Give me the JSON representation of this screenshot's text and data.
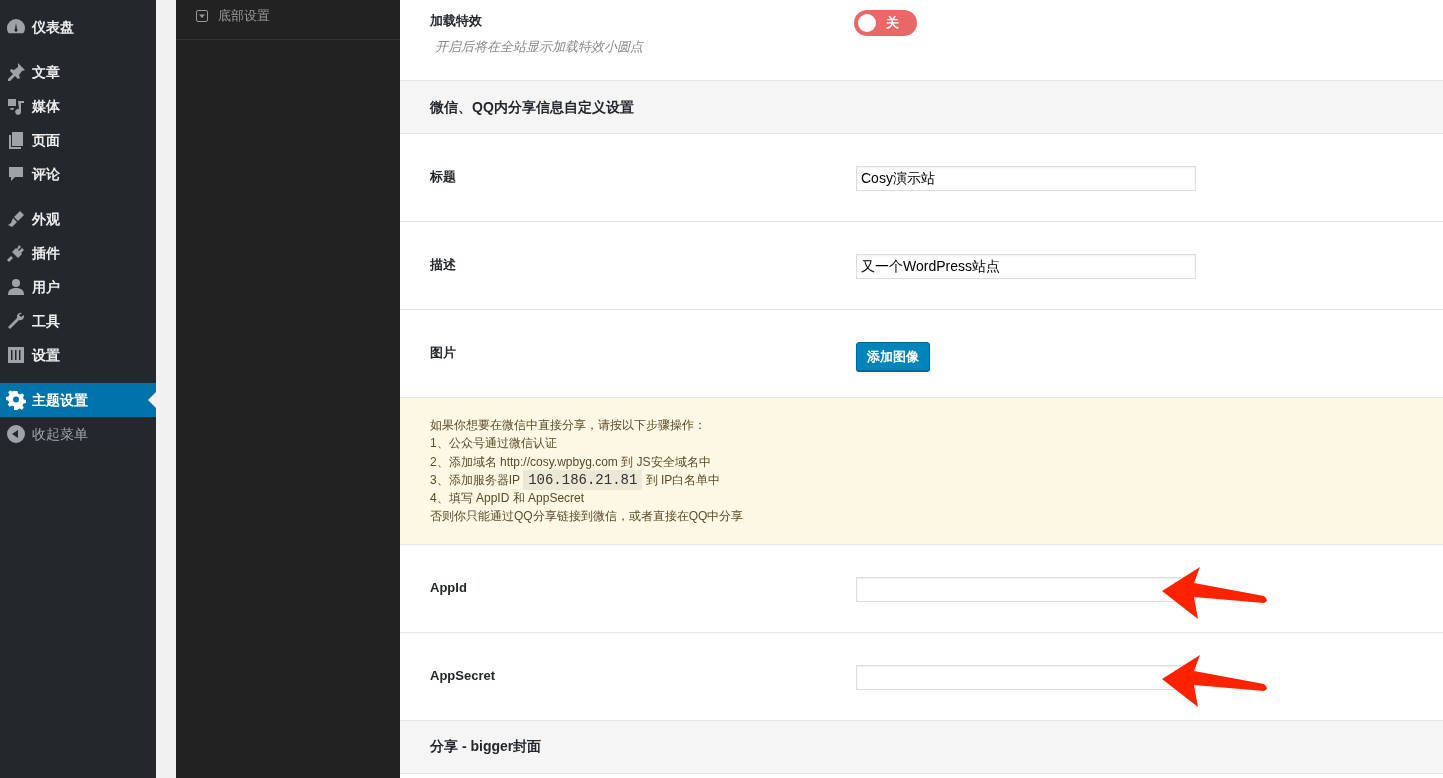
{
  "sidebar": {
    "groups": [
      [
        {
          "label": "仪表盘",
          "selected": false
        }
      ],
      [
        {
          "label": "文章",
          "selected": false
        },
        {
          "label": "媒体",
          "selected": false
        },
        {
          "label": "页面",
          "selected": false
        },
        {
          "label": "评论",
          "selected": false
        }
      ],
      [
        {
          "label": "外观",
          "selected": false
        },
        {
          "label": "插件",
          "selected": false
        },
        {
          "label": "用户",
          "selected": false
        },
        {
          "label": "工具",
          "selected": false
        },
        {
          "label": "设置",
          "selected": false
        }
      ],
      [
        {
          "label": "主题设置",
          "selected": true
        },
        {
          "label": "收起菜单",
          "selected": false
        }
      ]
    ]
  },
  "subpanel": {
    "items": [
      {
        "label": "底部设置"
      }
    ]
  },
  "rows": [
    {
      "kind": "toggle",
      "label": "加载特效",
      "description": "开启后将在全站显示加载特效小圆点",
      "on": false,
      "toggle_text": "关"
    },
    {
      "kind": "header",
      "label": "微信、QQ内分享信息自定义设置"
    },
    {
      "kind": "text",
      "label": "标题",
      "value": "Cosy演示站",
      "annotated": false
    },
    {
      "kind": "text",
      "label": "描述",
      "value": "又一个WordPress站点",
      "annotated": false
    },
    {
      "kind": "image",
      "label": "图片",
      "button": "添加图像"
    },
    {
      "kind": "notice",
      "lines": [
        [
          {
            "text": "如果你想要在微信中直接分享，请按以下步骤操作：",
            "code": false
          }
        ],
        [
          {
            "text": "1、公众号通过微信认证",
            "code": false
          }
        ],
        [
          {
            "text": "2、添加域名 http://cosy.wpbyg.com 到 JS安全域名中",
            "code": false
          }
        ],
        [
          {
            "text": "3、添加服务器IP ",
            "code": false
          },
          {
            "text": "106.186.21.81",
            "code": true
          },
          {
            "text": " 到 IP白名单中",
            "code": false
          }
        ],
        [
          {
            "text": "4、填写 AppID 和 AppSecret",
            "code": false
          }
        ],
        [
          {
            "text": "否则你只能通过QQ分享链接到微信，或者直接在QQ中分享",
            "code": false
          }
        ]
      ]
    },
    {
      "kind": "text",
      "label": "AppId",
      "value": "",
      "annotated": true
    },
    {
      "kind": "text",
      "label": "AppSecret",
      "value": "",
      "annotated": true
    },
    {
      "kind": "header",
      "label": "分享 - bigger封面"
    }
  ]
}
